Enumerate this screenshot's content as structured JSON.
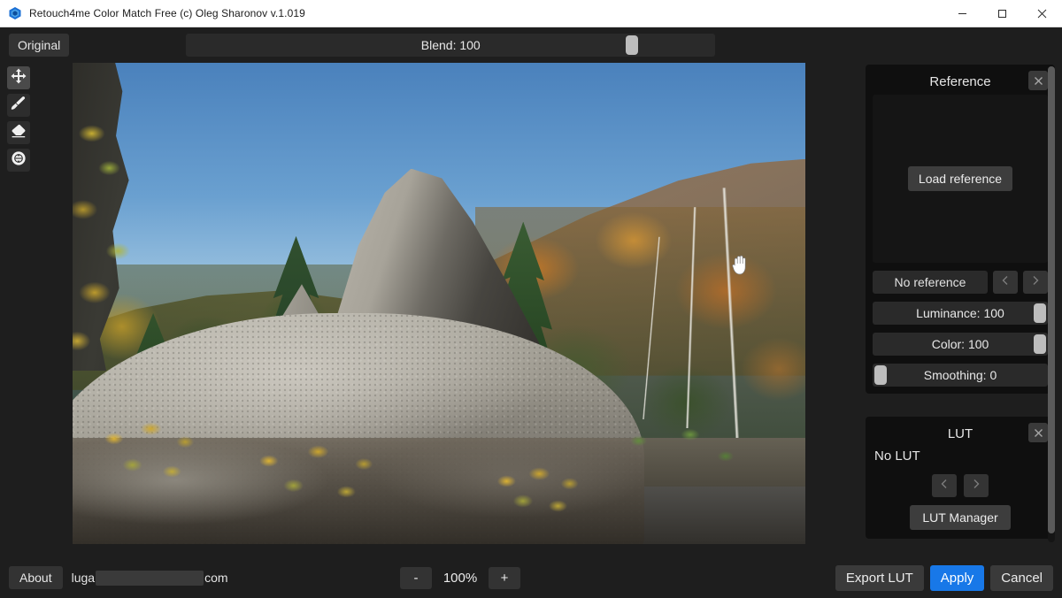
{
  "window": {
    "title": "Retouch4me Color Match Free (c) Oleg Sharonov v.1.019",
    "logo_icon": "retouch4me-hex-logo-icon",
    "minimize_icon": "minimize-icon",
    "maximize_icon": "maximize-icon",
    "close_icon": "close-icon"
  },
  "toolbar": {
    "original_label": "Original",
    "blend": {
      "label": "Blend: 100",
      "value": 100,
      "handle_percent": 71
    }
  },
  "tools": [
    {
      "name": "move-tool",
      "icon": "move-arrows-icon",
      "active": true
    },
    {
      "name": "brush-tool",
      "icon": "brush-icon",
      "active": false
    },
    {
      "name": "eraser-tool",
      "icon": "eraser-icon",
      "active": false
    },
    {
      "name": "compare-tool",
      "icon": "compare-circle-icon",
      "active": false
    }
  ],
  "canvas": {
    "cursor_icon": "open-hand-cursor-icon",
    "photo_alt": "autumn mountain landscape with large granite boulder and rock spire"
  },
  "reference_panel": {
    "title": "Reference",
    "close_icon": "close-icon",
    "load_button": "Load reference",
    "reference_name": "No reference",
    "prev_icon": "chevron-left-icon",
    "next_icon": "chevron-right-icon",
    "sliders": [
      {
        "name": "luminance",
        "label": "Luminance: 100",
        "value": 100,
        "handle_percent": 100
      },
      {
        "name": "color",
        "label": "Color: 100",
        "value": 100,
        "handle_percent": 100
      },
      {
        "name": "smoothing",
        "label": "Smoothing: 0",
        "value": 0,
        "handle_percent": 0
      }
    ]
  },
  "lut_panel": {
    "title": "LUT",
    "close_icon": "close-icon",
    "lut_name": "No LUT",
    "prev_icon": "chevron-left-icon",
    "next_icon": "chevron-right-icon",
    "manager_button": "LUT Manager"
  },
  "bottombar": {
    "about_label": "About",
    "account_prefix": "luga",
    "account_suffix": "com",
    "zoom_out_label": "-",
    "zoom_level": "100%",
    "zoom_in_label": "+",
    "export_lut_label": "Export LUT",
    "apply_label": "Apply",
    "cancel_label": "Cancel"
  },
  "colors": {
    "accent": "#1878e8",
    "panel_bg": "#0f0f0f",
    "app_bg": "#1e1e1e",
    "button_bg": "#333333",
    "slider_handle": "#bdbdbd"
  }
}
